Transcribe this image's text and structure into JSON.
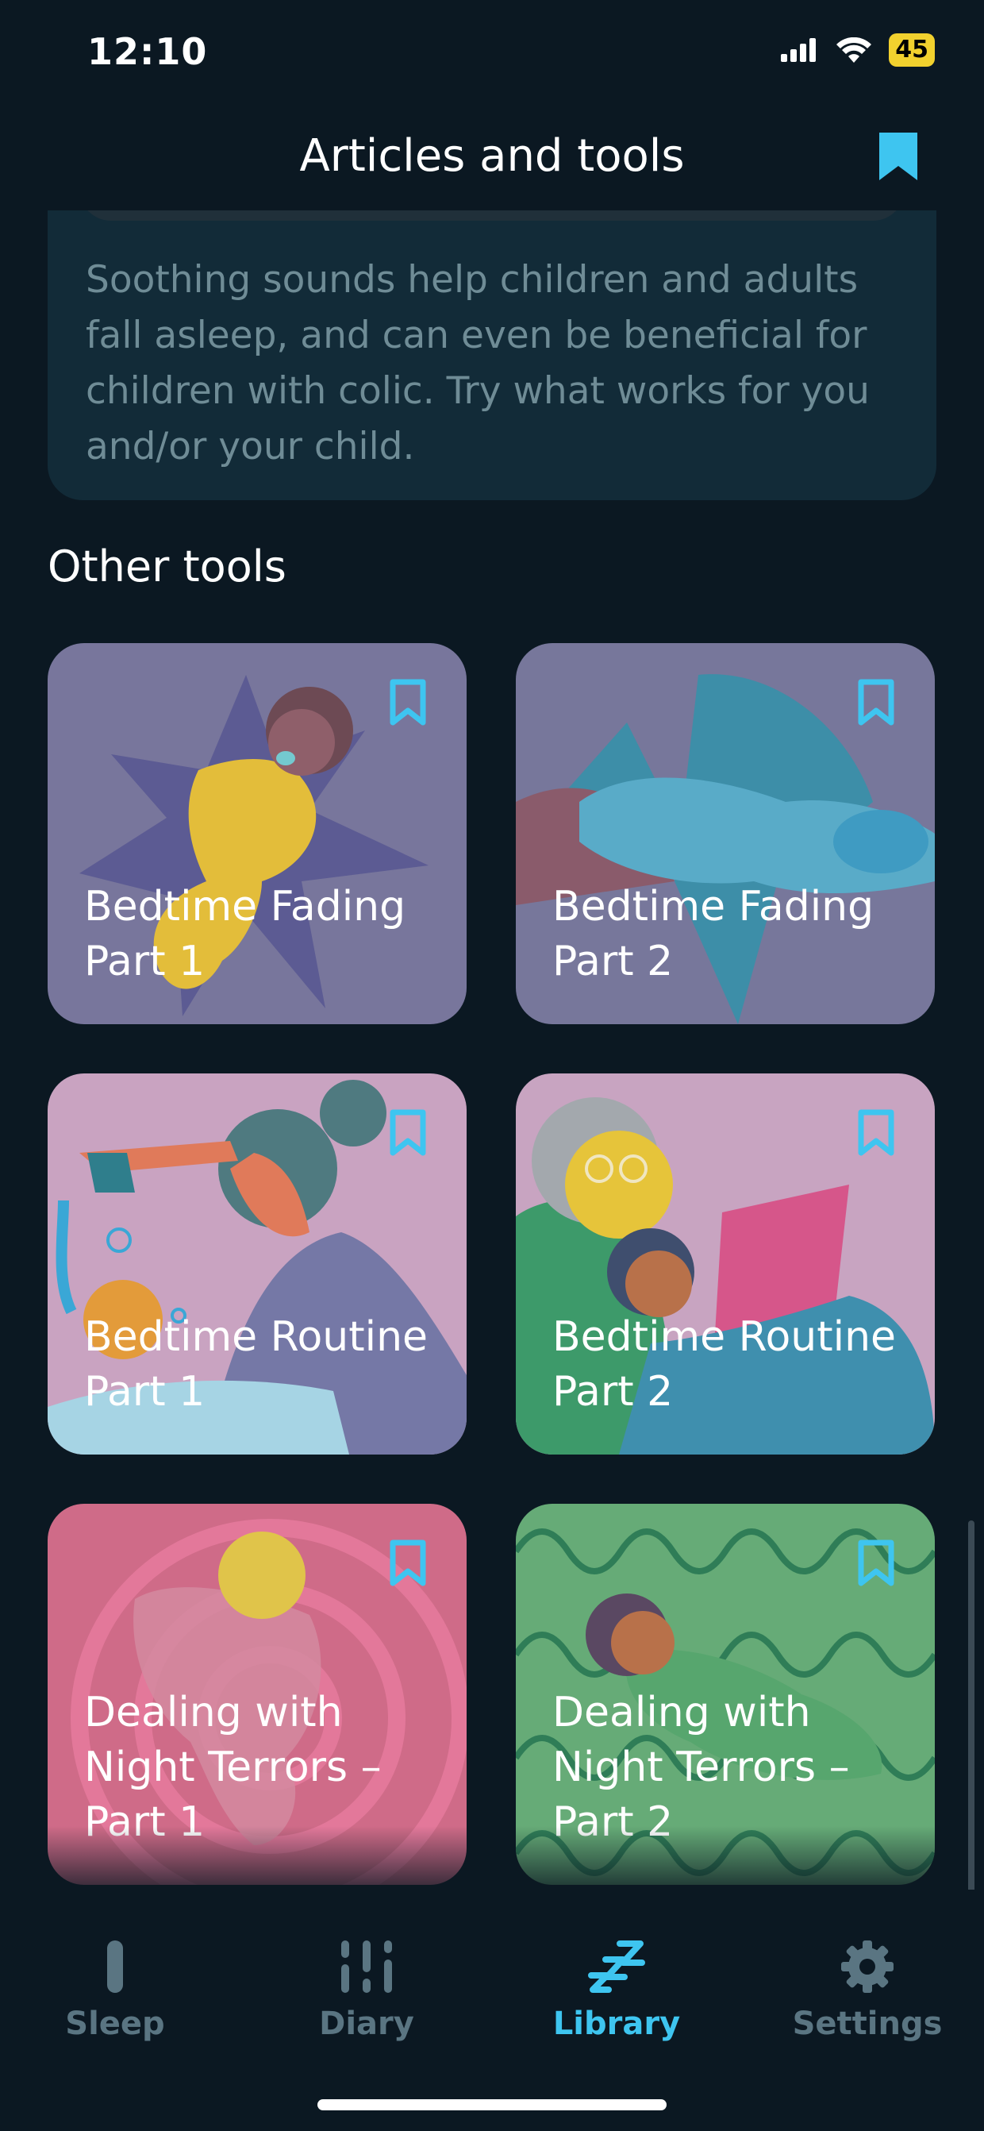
{
  "status_bar": {
    "time": "12:10",
    "battery": "45"
  },
  "header": {
    "title": "Articles and tools"
  },
  "intro_card": {
    "text": "Soothing sounds help children and adults fall asleep, and can even be beneficial for children with colic. Try what works for you and/or your child."
  },
  "section": {
    "title": "Other tools"
  },
  "tools": [
    {
      "label": "Bedtime Fading Part 1"
    },
    {
      "label": "Bedtime Fading Part 2"
    },
    {
      "label": "Bedtime Routine Part 1"
    },
    {
      "label": "Bedtime Routine Part 2"
    },
    {
      "label": "Dealing with Night Terrors – Part 1"
    },
    {
      "label": "Dealing with Night Terrors – Part 2"
    }
  ],
  "tab_bar": {
    "items": [
      {
        "label": "Sleep",
        "icon": "sleep-icon"
      },
      {
        "label": "Diary",
        "icon": "diary-icon"
      },
      {
        "label": "Library",
        "icon": "library-icon",
        "active": true
      },
      {
        "label": "Settings",
        "icon": "gear-icon"
      }
    ]
  },
  "colors": {
    "accent": "#3ec5f0",
    "background": "#0b1822"
  }
}
